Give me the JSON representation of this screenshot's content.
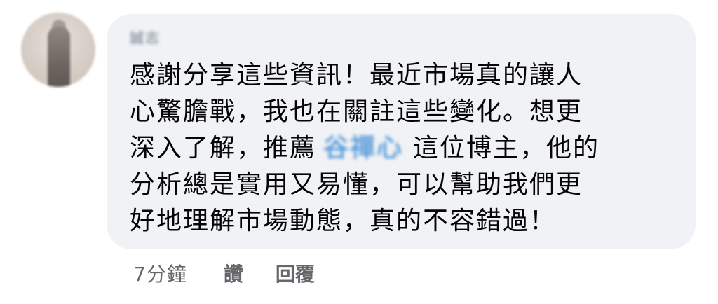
{
  "comment": {
    "author": "誠志",
    "lines": {
      "l1": "感謝分享這些資訊！最近市場真的讓人",
      "l2": "心驚膽戰，我也在關註這些變化。想更",
      "l3_before": "深入了解，推薦",
      "mention": "谷禪心",
      "l3_after": "這位博主，他的",
      "l4": "分析總是實用又易懂，可以幫助我們更",
      "l5": "好地理解市場動態，真的不容錯過！"
    }
  },
  "actions": {
    "timestamp": "7分鐘",
    "like_label": "讚",
    "reply_label": "回覆"
  },
  "colors": {
    "bubble_bg": "#f0f2f5",
    "text": "#050505",
    "meta_text": "#65676b",
    "mention": "#5a9ddb"
  }
}
